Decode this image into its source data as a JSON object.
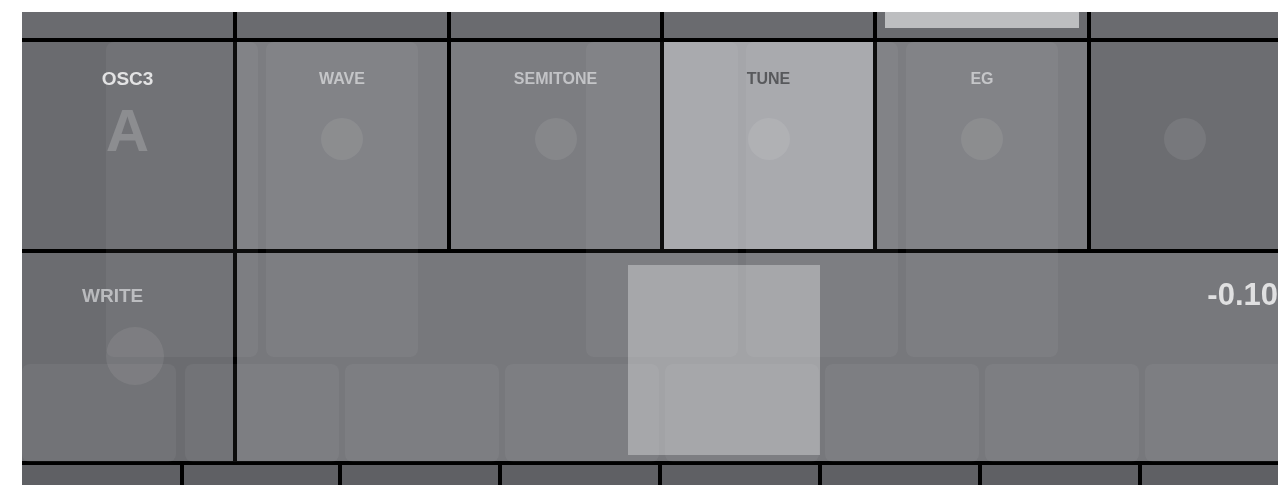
{
  "top_tabs": [
    {
      "selected": false
    },
    {
      "selected": false
    },
    {
      "selected": false
    },
    {
      "selected": false
    },
    {
      "selected": true
    },
    {
      "selected": false
    }
  ],
  "header": {
    "label": "OSC3",
    "value": "A"
  },
  "params": [
    {
      "label": "WAVE",
      "selected": false
    },
    {
      "label": "SEMITONE",
      "selected": false
    },
    {
      "label": "TUNE",
      "selected": true
    },
    {
      "label": "EG",
      "selected": false
    },
    {
      "selected": false
    }
  ],
  "write_button": {
    "label": "WRITE"
  },
  "slider": {
    "value": "-0.10",
    "level": 0.46
  }
}
